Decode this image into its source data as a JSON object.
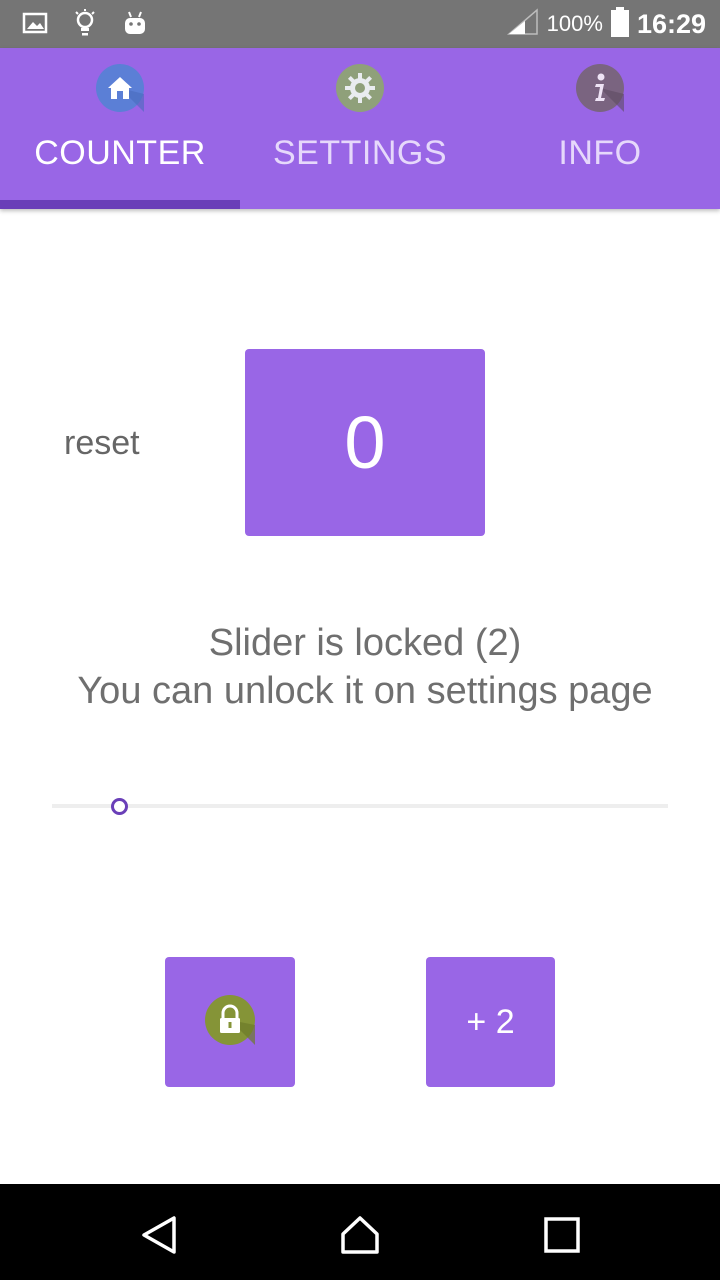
{
  "status_bar": {
    "icons": [
      "gallery-icon",
      "lightbulb-icon",
      "android-icon",
      "signal-icon",
      "battery-icon"
    ],
    "battery_percent": "100%",
    "time": "16:29"
  },
  "tabs": [
    {
      "label": "COUNTER",
      "icon": "home-icon",
      "active": true
    },
    {
      "label": "SETTINGS",
      "icon": "gear-icon",
      "active": false
    },
    {
      "label": "INFO",
      "icon": "info-icon",
      "active": false
    }
  ],
  "counter": {
    "reset_label": "reset",
    "value": "0"
  },
  "message": {
    "line1": "Slider is locked (2)",
    "line2": "You can unlock it on settings page"
  },
  "slider": {
    "value": 2,
    "locked": true
  },
  "buttons": {
    "lock_icon": "lock-icon",
    "increment_label": "+ 2"
  },
  "navigation": [
    "back-icon",
    "home-icon",
    "recents-icon"
  ],
  "colors": {
    "primary": "#9966e6",
    "primary_dark": "#6a3fb8",
    "status_bar": "#757575",
    "text_secondary": "#6f6f6f"
  }
}
